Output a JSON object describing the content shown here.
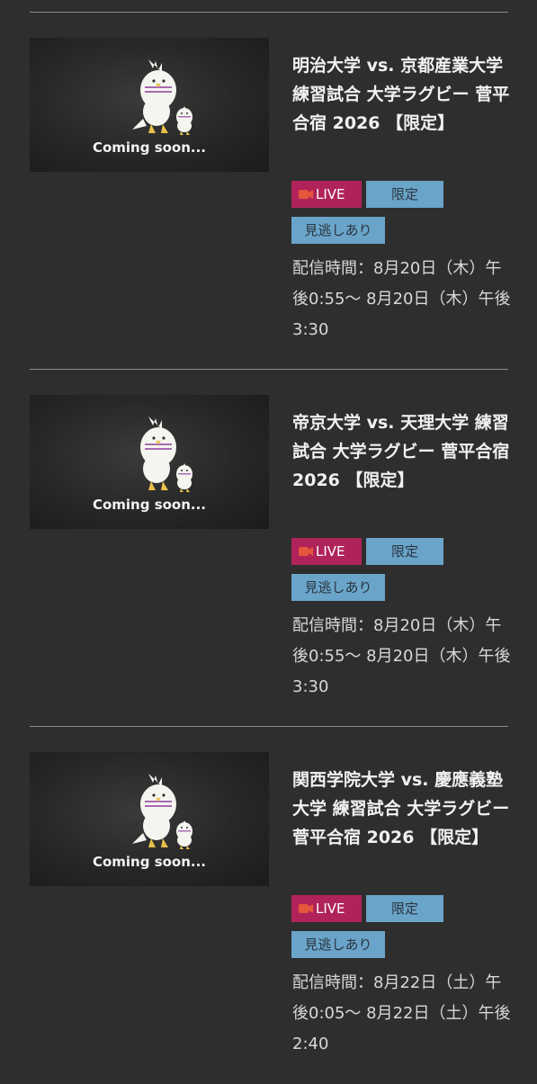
{
  "thumbnail": {
    "coming_soon": "Coming soon..."
  },
  "events": [
    {
      "title": "明治大学 vs. 京都産業大学 練習試合 大学ラグビー 菅平合宿 2026 【限定】",
      "badges": {
        "live": "LIVE",
        "limited": "限定",
        "rewatch": "見逃しあり"
      },
      "period": "配信時間：8月20日（木）午後0:55〜 8月20日（木）午後3:30"
    },
    {
      "title": "帝京大学 vs. 天理大学 練習試合 大学ラグビー 菅平合宿 2026 【限定】",
      "badges": {
        "live": "LIVE",
        "limited": "限定",
        "rewatch": "見逃しあり"
      },
      "period": "配信時間：8月20日（木）午後0:55〜 8月20日（木）午後3:30"
    },
    {
      "title": "関西学院大学 vs. 慶應義塾大学 練習試合 大学ラグビー 菅平合宿 2026 【限定】",
      "badges": {
        "live": "LIVE",
        "limited": "限定",
        "rewatch": "見逃しあり"
      },
      "period": "配信時間：8月22日（土）午後0:05〜 8月22日（土）午後2:40"
    }
  ],
  "colors": {
    "live_badge": "#b0235a",
    "live_icon": "#e5563c",
    "tag_badge": "#6aa4c9",
    "background": "#2e2e2e"
  }
}
